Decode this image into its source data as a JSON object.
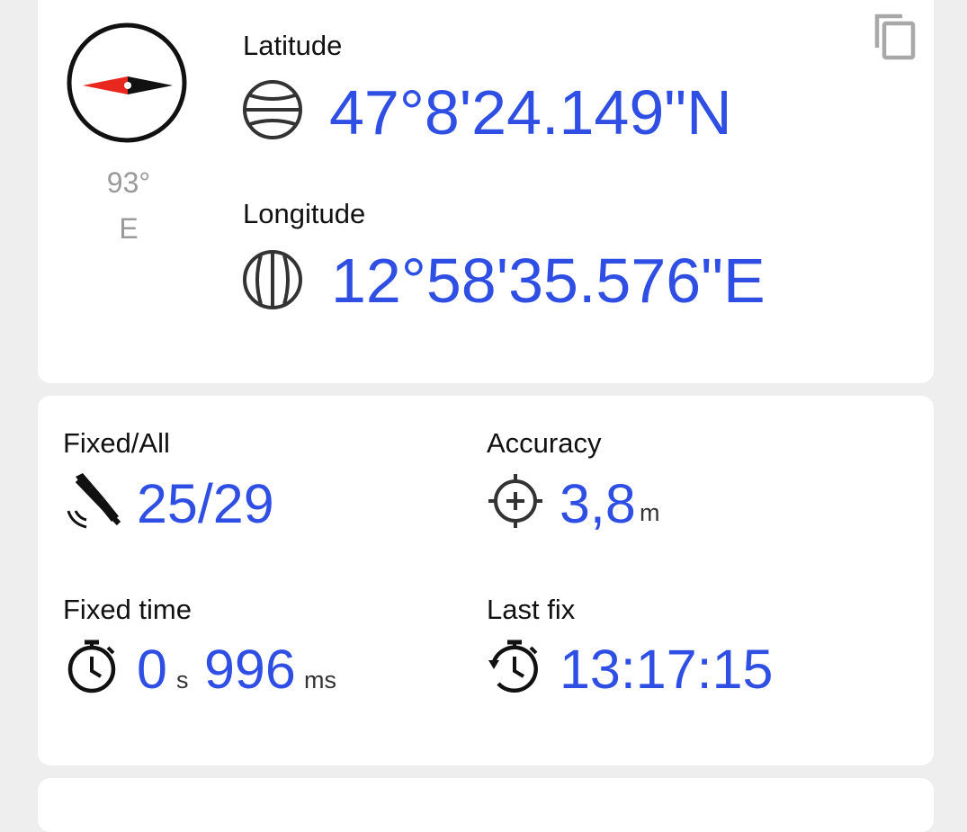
{
  "location": {
    "heading_degrees": "93°",
    "heading_direction": "E",
    "latitude_label": "Latitude",
    "latitude_value": "47°8'24.149\"N",
    "longitude_label": "Longitude",
    "longitude_value": "12°58'35.576\"E",
    "icons": {
      "compass": "compass-icon",
      "copy": "copy-icon",
      "latitude": "latitude-globe-icon",
      "longitude": "longitude-globe-icon"
    }
  },
  "stats": {
    "fixed_all_label": "Fixed/All",
    "fixed_all_value": "25/29",
    "accuracy_label": "Accuracy",
    "accuracy_value": "3,8",
    "accuracy_unit": "m",
    "fixed_time_label": "Fixed time",
    "fixed_time_seconds": "0",
    "fixed_time_seconds_unit": "s",
    "fixed_time_ms": "996",
    "fixed_time_ms_unit": "ms",
    "last_fix_label": "Last fix",
    "last_fix_value": "13:17:15",
    "icons": {
      "satellite": "satellite-icon",
      "crosshair": "crosshair-icon",
      "stopwatch": "stopwatch-icon",
      "stopwatch_history": "stopwatch-history-icon"
    }
  },
  "colors": {
    "accent": "#2f4fe4",
    "compass_needle_north": "#e8281e",
    "background": "#eeeeee",
    "card": "#ffffff"
  }
}
